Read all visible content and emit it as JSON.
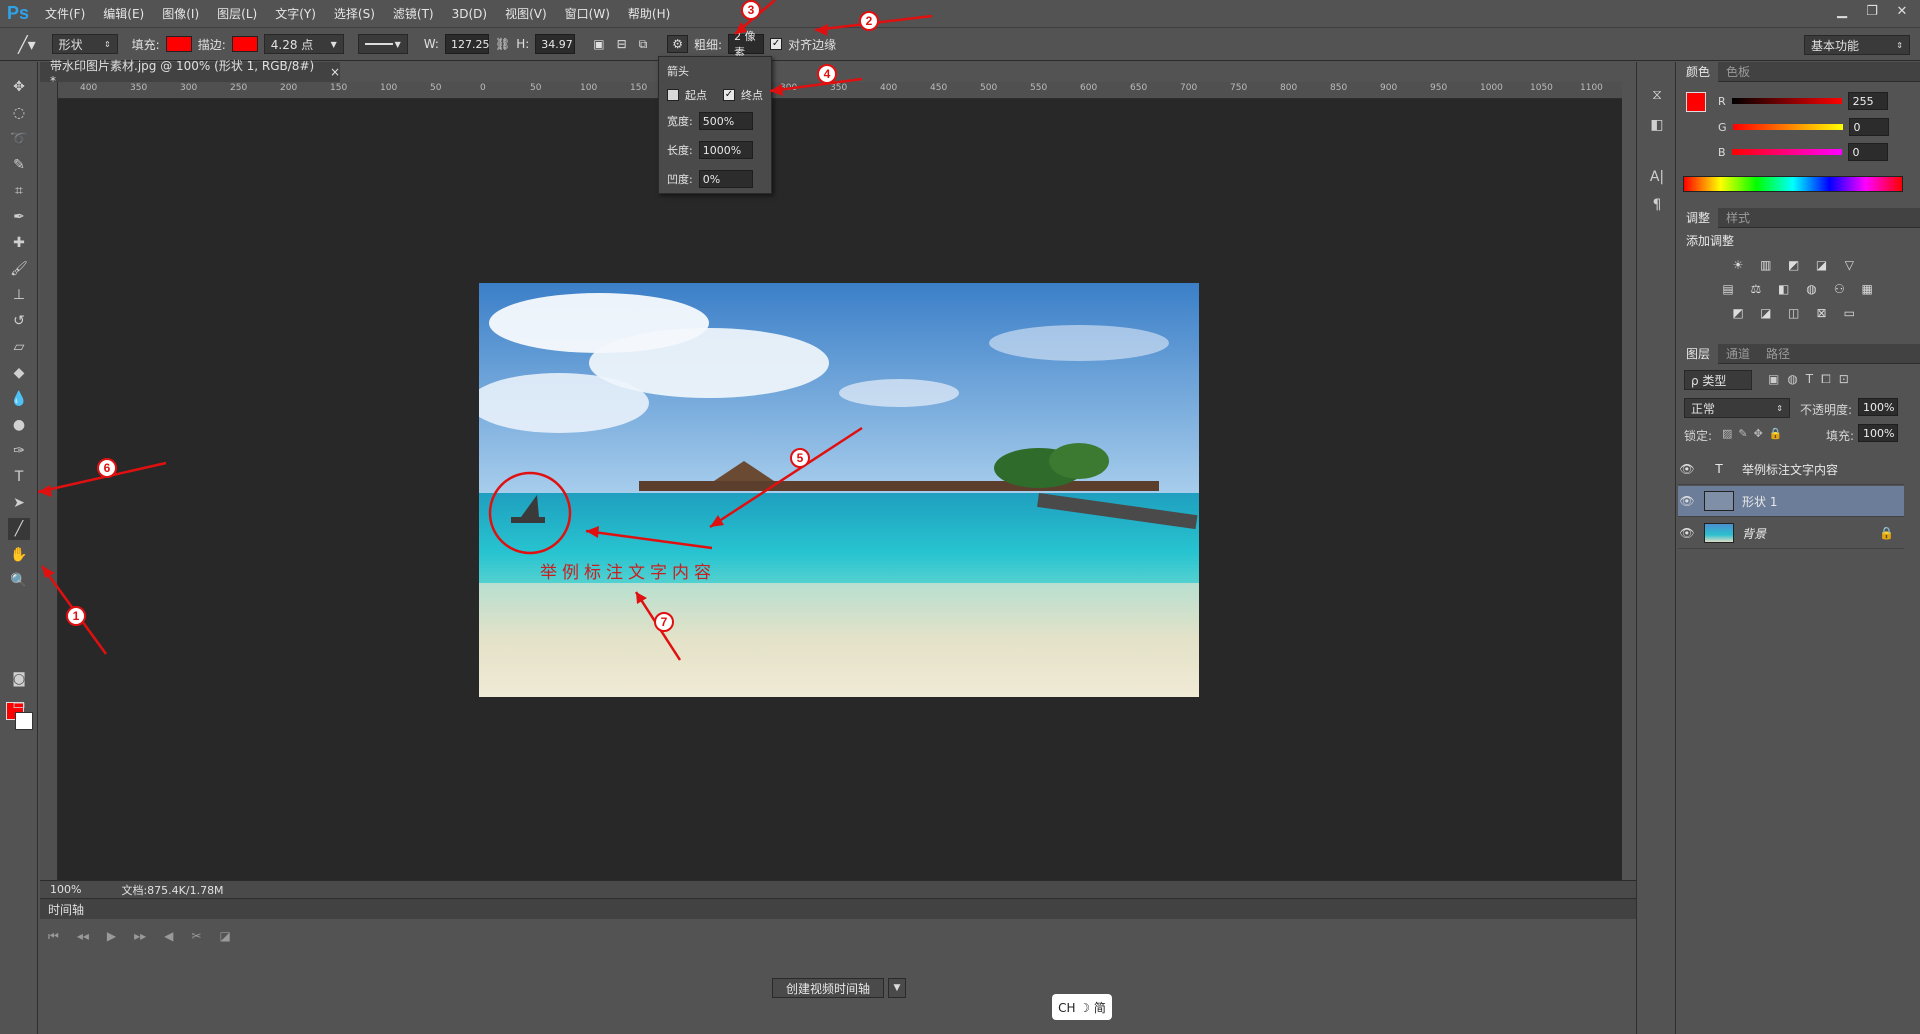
{
  "app": {
    "logo": "Ps"
  },
  "menubar": {
    "items": [
      "文件(F)",
      "编辑(E)",
      "图像(I)",
      "图层(L)",
      "文字(Y)",
      "选择(S)",
      "滤镜(T)",
      "3D(D)",
      "视图(V)",
      "窗口(W)",
      "帮助(H)"
    ]
  },
  "window_controls": {
    "minimize": "▁",
    "restore": "❐",
    "close": "✕"
  },
  "options": {
    "mode": "形状",
    "fill_label": "填充:",
    "stroke_label": "描边:",
    "stroke_size": "4.28 点",
    "w_label": "W:",
    "w_value": "127.25",
    "h_label": "H:",
    "h_value": "34.97",
    "weight_label": "粗细:",
    "weight_value": "2 像素",
    "align_label": "对齐边缘",
    "workspace": "基本功能",
    "fill_color": "#ff0000",
    "stroke_color": "#ff0000"
  },
  "arrow_popup": {
    "title": "箭头",
    "start_label": "起点",
    "start_checked": false,
    "end_label": "终点",
    "end_checked": true,
    "width_label": "宽度:",
    "width_value": "500%",
    "length_label": "长度:",
    "length_value": "1000%",
    "concavity_label": "凹度:",
    "concavity_value": "0%"
  },
  "document": {
    "tab_title": "带水印图片素材.jpg @ 100% (形状 1, RGB/8#) *",
    "tab_close": "×",
    "zoom": "100%",
    "doc_info": "文档:875.4K/1.78M",
    "annotation_text": "举例标注文字内容"
  },
  "ruler": {
    "ticks": [
      "400",
      "350",
      "300",
      "250",
      "200",
      "150",
      "100",
      "50",
      "0",
      "50",
      "100",
      "150",
      "200",
      "250",
      "300",
      "350",
      "400",
      "450",
      "500",
      "550",
      "600",
      "650",
      "700",
      "750",
      "800",
      "850",
      "900",
      "950",
      "1000",
      "1050",
      "1100"
    ]
  },
  "timeline": {
    "tab": "时间轴",
    "create_button": "创建视频时间轴",
    "dropdown_icon": "▼"
  },
  "ime": {
    "text": "CH ☽ 简"
  },
  "panels": {
    "color_tabs": [
      "颜色",
      "色板"
    ],
    "r_label": "R",
    "r_value": "255",
    "g_label": "G",
    "g_value": "0",
    "b_label": "B",
    "b_value": "0",
    "adjust_tabs": [
      "调整",
      "样式"
    ],
    "adjust_title": "添加调整",
    "layer_tabs": [
      "图层",
      "通道",
      "路径"
    ],
    "kind_filter": "ρ 类型",
    "blend_mode": "正常",
    "opacity_label": "不透明度:",
    "opacity_value": "100%",
    "lock_label": "锁定:",
    "fill_label": "填充:",
    "fill_value": "100%",
    "layers": [
      {
        "name": "举例标注文字内容",
        "type": "T"
      },
      {
        "name": "形状 1",
        "type": "shape"
      },
      {
        "name": "背景",
        "type": "image"
      }
    ]
  },
  "annotations": [
    "1",
    "2",
    "3",
    "4",
    "5",
    "6",
    "7"
  ]
}
